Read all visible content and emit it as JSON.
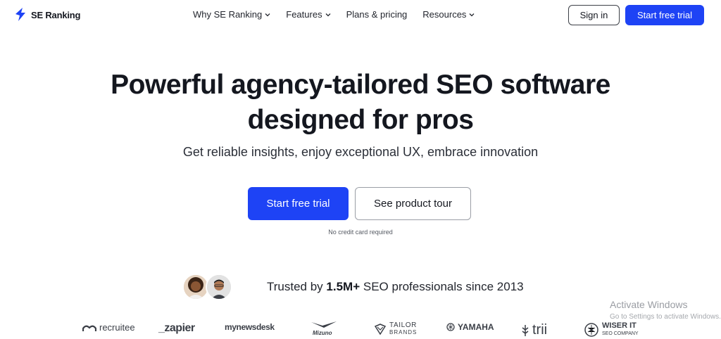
{
  "header": {
    "brand": "SE Ranking",
    "nav": [
      {
        "label": "Why SE Ranking",
        "has_dropdown": true
      },
      {
        "label": "Features",
        "has_dropdown": true
      },
      {
        "label": "Plans & pricing",
        "has_dropdown": false
      },
      {
        "label": "Resources",
        "has_dropdown": true
      }
    ],
    "signin_label": "Sign in",
    "trial_label": "Start free trial"
  },
  "hero": {
    "title_line1": "Powerful agency-tailored SEO software",
    "title_line2": "designed for pros",
    "subtitle": "Get reliable insights, enjoy exceptional UX, embrace innovation",
    "cta_primary": "Start free trial",
    "cta_secondary": "See product tour",
    "note": "No credit card required"
  },
  "trust": {
    "prefix": "Trusted by ",
    "highlight": "1.5M+",
    "suffix": " SEO professionals since 2013"
  },
  "logos": {
    "recruitee": "recruitee",
    "zapier": "_zapier",
    "mynewsdesk": "mynewsdesk",
    "mizuno": "Mizuno",
    "tailor_line1": "TAILOR",
    "tailor_line2": "BRANDS",
    "yamaha": "YAMAHA",
    "trii": "trii",
    "wiser_line1": "WISER IT",
    "wiser_line2": "SEO COMPANY"
  },
  "watermark": {
    "title": "Activate Windows",
    "subtitle": "Go to Settings to activate Windows."
  },
  "colors": {
    "accent": "#1e43f5",
    "text": "#14171f"
  }
}
